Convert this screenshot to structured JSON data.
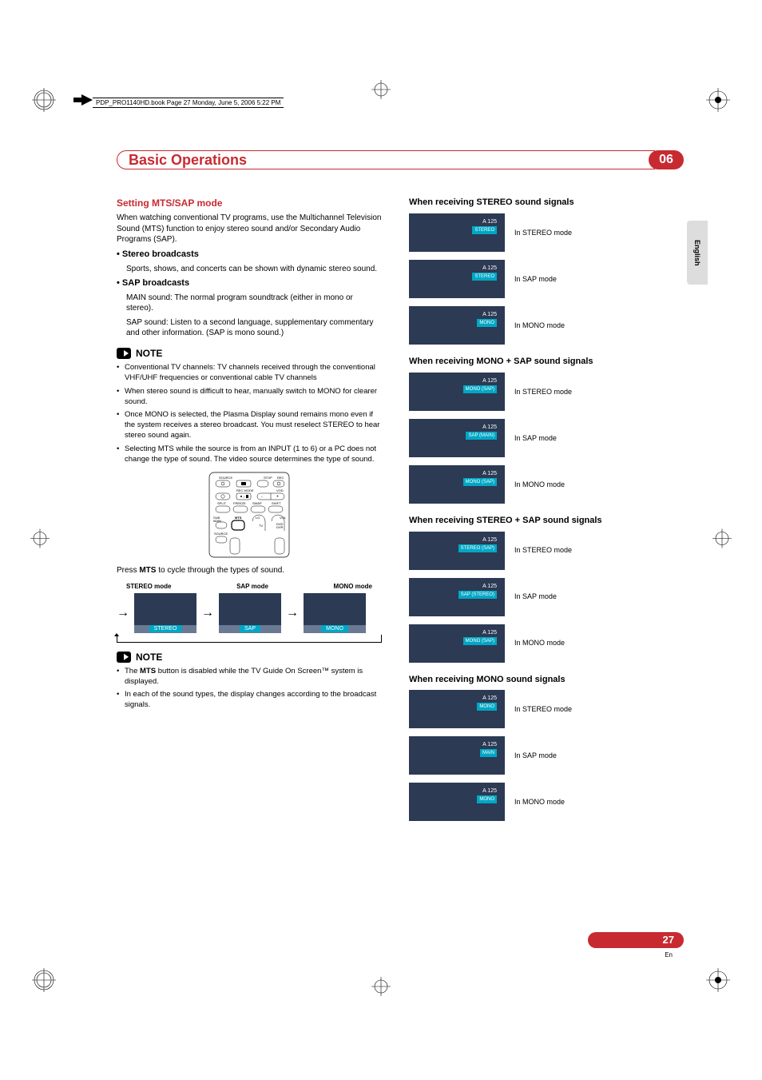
{
  "meta": {
    "header_line": "PDP_PRO1140HD.book  Page 27  Monday, June 5, 2006  5:22 PM"
  },
  "chapter": {
    "title": "Basic Operations",
    "number": "06"
  },
  "side_tab": "English",
  "left": {
    "h3": "Setting MTS/SAP mode",
    "intro": "When watching conventional TV programs, use the Multichannel Television Sound (MTS) function to enjoy stereo sound and/or Secondary Audio Programs (SAP).",
    "b1_title": "Stereo broadcasts",
    "b1_body": "Sports, shows, and concerts can be shown with dynamic stereo sound.",
    "b2_title": "SAP broadcasts",
    "b2_body1": "MAIN sound: The normal program soundtrack (either in mono or stereo).",
    "b2_body2": "SAP sound: Listen to a second language, supplementary commentary and other information. (SAP is mono sound.)",
    "note_label": "NOTE",
    "notes1": [
      "Conventional TV channels: TV channels received through the conventional VHF/UHF frequencies or conventional cable TV channels",
      "When stereo sound is difficult to hear, manually switch to MONO for clearer sound.",
      "Once MONO is selected, the Plasma Display sound remains mono even if the system receives a stereo broadcast. You must reselect STEREO to hear stereo sound again.",
      "Selecting MTS while the source is from an INPUT (1 to 6) or a PC does not change the type of sound. The video source determines the type of sound."
    ],
    "press_pre": "Press ",
    "press_mts": "MTS",
    "press_post": " to cycle through the types of sound.",
    "cycle_labels": [
      "STEREO mode",
      "SAP mode",
      "MONO mode"
    ],
    "cycle_tags": [
      "STEREO",
      "SAP",
      "MONO"
    ],
    "notes2": [
      "The MTS button is disabled while the TV Guide On Screen™ system is displayed.",
      "In each of the sound types, the display changes according to the broadcast signals."
    ],
    "notes2_b": "MTS"
  },
  "right": {
    "ch_label": "A  125",
    "sections": [
      {
        "title": "When receiving STEREO sound signals",
        "rows": [
          {
            "badge": "STEREO",
            "label": "In STEREO mode"
          },
          {
            "badge": "STEREO",
            "label": "In SAP mode"
          },
          {
            "badge": "MONO",
            "label": "In MONO mode"
          }
        ]
      },
      {
        "title": "When receiving MONO + SAP sound signals",
        "rows": [
          {
            "badge": "MONO (SAP)",
            "label": "In STEREO mode"
          },
          {
            "badge": "SAP (MAIN)",
            "label": "In SAP mode"
          },
          {
            "badge": "MONO (SAP)",
            "label": "In MONO mode"
          }
        ]
      },
      {
        "title": "When receiving STEREO + SAP sound signals",
        "rows": [
          {
            "badge": "STEREO (SAP)",
            "label": "In STEREO mode"
          },
          {
            "badge": "SAP (STEREO)",
            "label": "In SAP mode"
          },
          {
            "badge": "MONO (SAP)",
            "label": "In MONO mode"
          }
        ]
      },
      {
        "title": "When receiving MONO sound signals",
        "rows": [
          {
            "badge": "MONO",
            "label": "In STEREO mode"
          },
          {
            "badge": "MAIN",
            "label": "In SAP mode"
          },
          {
            "badge": "MONO",
            "label": "In MONO mode"
          }
        ]
      }
    ]
  },
  "footer": {
    "page": "27",
    "lang": "En"
  },
  "remote_labels": {
    "source": "SOURCE",
    "stop": "STOP",
    "rec": "REC",
    "rec_mode": "REC MODE",
    "vod": "VOD",
    "split": "SPLIT",
    "freeze": "FREEZE",
    "swap": "SWAP",
    "shift": "SHIFT",
    "sub_main": "SUB\nMAIN",
    "mts": "MTS",
    "lg": "LG",
    "vol": "VOL",
    "source2": "SOURCE",
    "tv": "TV",
    "dvd": "DVD\nDVR"
  }
}
